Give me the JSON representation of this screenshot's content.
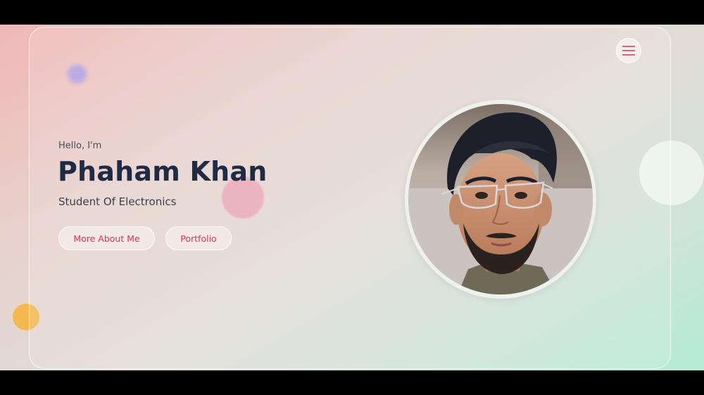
{
  "hero": {
    "greeting": "Hello, I'm",
    "name": "Phaham Khan",
    "role": "Student Of Electronics"
  },
  "actions": {
    "about_label": "More About Me",
    "portfolio_label": "Portfolio"
  },
  "icons": {
    "menu": "hamburger-menu-icon",
    "profile": "profile-photo"
  },
  "colors": {
    "accent": "#d8335f",
    "name": "#1f2a44",
    "text": "#3d404a"
  }
}
